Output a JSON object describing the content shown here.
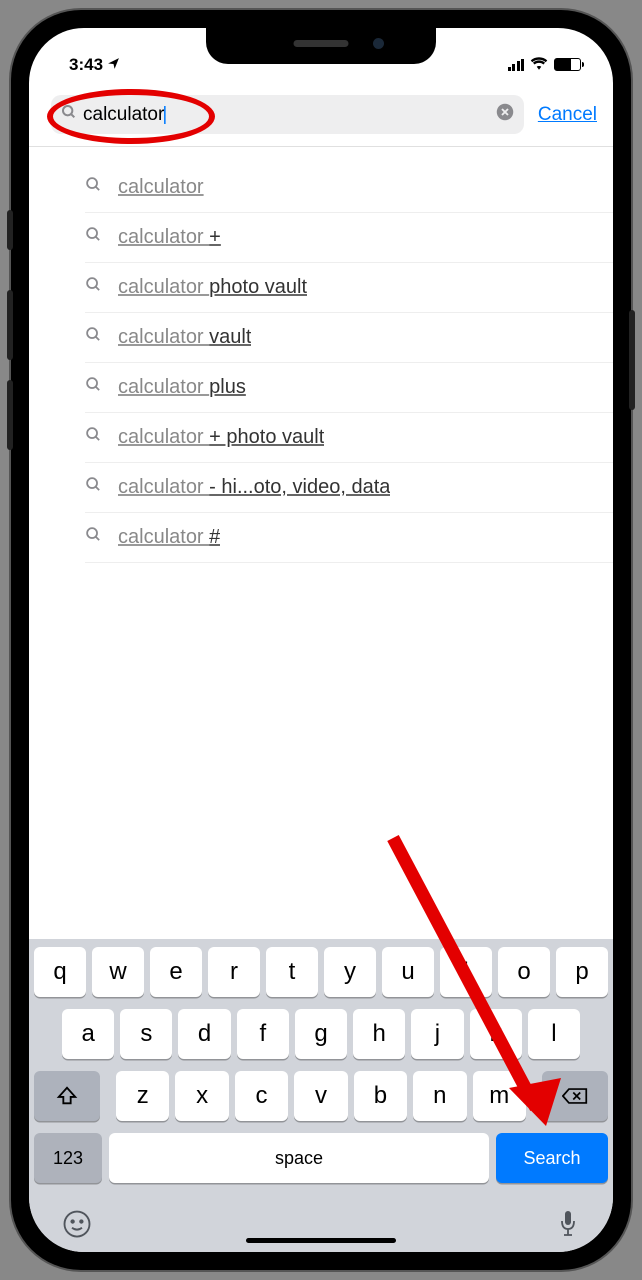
{
  "status": {
    "time": "3:43",
    "location_icon": "↗"
  },
  "search": {
    "value": "calculator",
    "clear_icon": "✕",
    "cancel_label": "Cancel"
  },
  "suggestions": [
    {
      "match": "calculator",
      "rest": ""
    },
    {
      "match": "calculator ",
      "rest": "+"
    },
    {
      "match": "calculator ",
      "rest": "photo vault"
    },
    {
      "match": "calculator ",
      "rest": "vault"
    },
    {
      "match": "calculator ",
      "rest": "plus"
    },
    {
      "match": "calculator ",
      "rest": "+ photo vault"
    },
    {
      "match": "calculator ",
      "rest": "- hi...oto, video, data"
    },
    {
      "match": "calculator ",
      "rest": "#"
    }
  ],
  "keyboard": {
    "row1": [
      "q",
      "w",
      "e",
      "r",
      "t",
      "y",
      "u",
      "i",
      "o",
      "p"
    ],
    "row2": [
      "a",
      "s",
      "d",
      "f",
      "g",
      "h",
      "j",
      "k",
      "l"
    ],
    "row3": [
      "z",
      "x",
      "c",
      "v",
      "b",
      "n",
      "m"
    ],
    "numbers_label": "123",
    "space_label": "space",
    "search_label": "Search"
  }
}
